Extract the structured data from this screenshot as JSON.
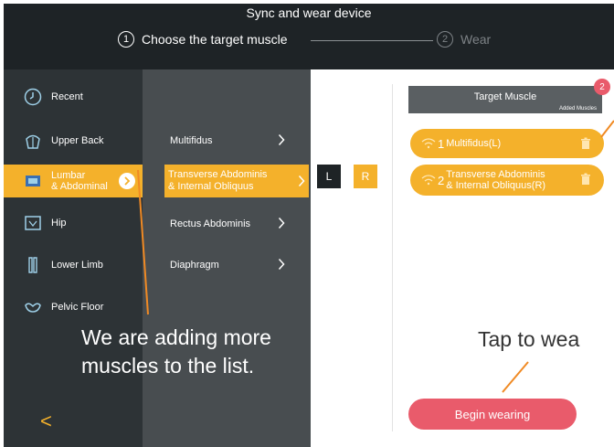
{
  "header": {
    "title": "Sync and wear device",
    "steps": [
      {
        "num": "1",
        "label": "Choose the target muscle"
      },
      {
        "num": "2",
        "label": "Wear"
      }
    ]
  },
  "sidebar": {
    "items": [
      {
        "label": "Recent",
        "icon": "clock-icon"
      },
      {
        "label": "Upper Back",
        "icon": "upper-back-icon"
      },
      {
        "label": "Lumbar\n& Abdominal",
        "icon": "lumbar-icon",
        "active": true
      },
      {
        "label": "Hip",
        "icon": "hip-icon"
      },
      {
        "label": "Lower Limb",
        "icon": "lower-limb-icon"
      },
      {
        "label": "Pelvic Floor",
        "icon": "pelvic-floor-icon"
      }
    ],
    "back_glyph": "<"
  },
  "muscles": {
    "items": [
      {
        "label": "Multifidus"
      },
      {
        "label": "Transverse Abdominis\n& Internal Obliquus",
        "active": true
      },
      {
        "label": "Rectus Abdominis"
      },
      {
        "label": "Diaphragm"
      }
    ],
    "side_left": "L",
    "side_right": "R"
  },
  "target": {
    "title": "Target Muscle",
    "subtitle": "Added Muscles",
    "count": "2",
    "selected": [
      {
        "index": "1",
        "label": "Multifidus(L)"
      },
      {
        "index": "2",
        "label": "Transverse Abdominis\n& Internal Obliquus(R)"
      }
    ],
    "begin_label": "Begin wearing"
  },
  "annotations": {
    "left": "We are adding more muscles to the list.",
    "right": "Tap to wea"
  },
  "colors": {
    "header_bg": "#1e2326",
    "sidebar_bg": "#2d3336",
    "list_bg": "#484d50",
    "accent": "#f4b12b",
    "begin_button": "#e95b6b",
    "callout_line": "#f08a24"
  }
}
